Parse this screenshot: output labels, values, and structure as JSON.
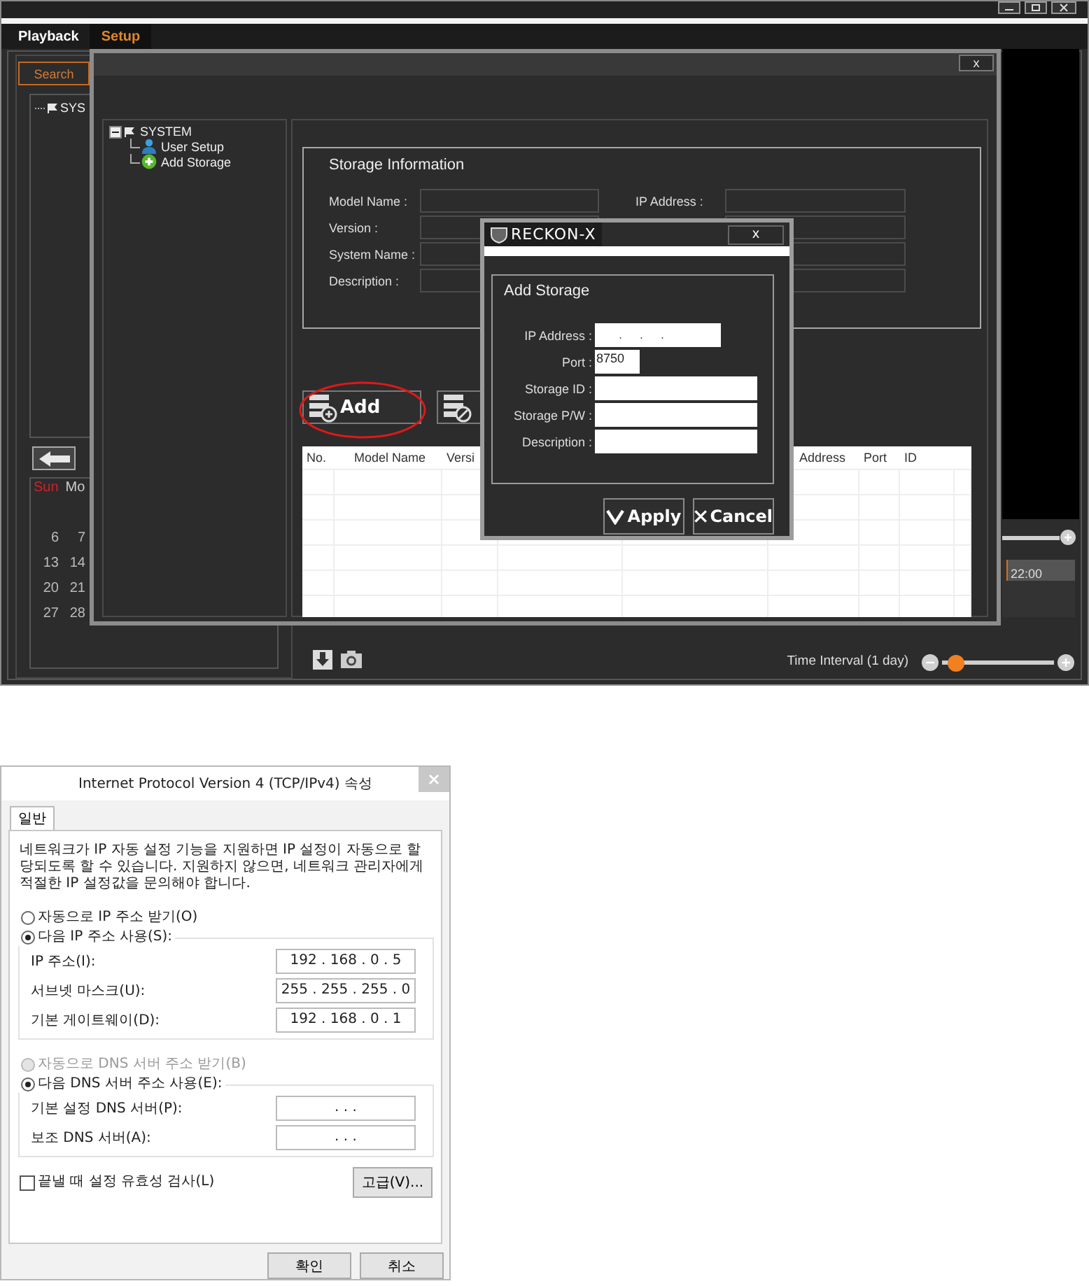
{
  "app": {
    "tabs": [
      {
        "label": "Playback",
        "selected": false
      },
      {
        "label": "Setup",
        "selected": true
      }
    ],
    "search_button": "Search",
    "device_tree": {
      "label": "SYS"
    },
    "calendar": {
      "weekdays": [
        {
          "label": "Sun",
          "weekend": true
        },
        {
          "label": "Mo",
          "weekend": false
        }
      ],
      "weeks": [
        [
          "6",
          "7"
        ],
        [
          "13",
          "14"
        ],
        [
          "20",
          "21"
        ],
        [
          "27",
          "28"
        ]
      ]
    },
    "timeline": {
      "time_label": "22:00"
    },
    "time_interval": {
      "label": "Time Interval (1 day)",
      "level": 0.06
    }
  },
  "setup_window": {
    "close": "x",
    "tree": {
      "label": "SYSTEM",
      "expanded": true,
      "children": [
        {
          "label": "User Setup",
          "kind": "user"
        },
        {
          "label": "Add Storage",
          "kind": "add"
        }
      ]
    },
    "storage_info": {
      "title": "Storage Information",
      "fields": [
        {
          "label": "Model Name :"
        },
        {
          "label": "Version :"
        },
        {
          "label": "System Name :"
        },
        {
          "label": "Description :"
        }
      ],
      "right_label": "IP Address :"
    },
    "buttons": [
      {
        "label": "Add",
        "kind": "add",
        "highlighted": true
      },
      {
        "kind": "delete",
        "highlighted": false
      }
    ],
    "table": {
      "columns": [
        "No.",
        "Model Name",
        "Versi",
        "Address",
        "Port",
        "ID"
      ]
    }
  },
  "add_storage_dialog": {
    "brand": "RECKON-X",
    "close": "x",
    "title": "Add Storage",
    "fields": [
      {
        "label": "IP Address :",
        "kind": "ip",
        "value": ". . ."
      },
      {
        "label": "Port :",
        "kind": "short",
        "value": "8750"
      },
      {
        "label": "Storage ID :",
        "kind": "text"
      },
      {
        "label": "Storage P/W :",
        "kind": "text"
      },
      {
        "label": "Description :",
        "kind": "text"
      }
    ],
    "buttons": [
      {
        "label": "Apply",
        "kind": "apply"
      },
      {
        "label": "Cancel",
        "kind": "cancel"
      }
    ]
  },
  "ipv4_dialog": {
    "title": "Internet Protocol Version 4 (TCP/IPv4) 속성",
    "tabs": [
      {
        "label": "일반",
        "selected": true
      }
    ],
    "description": "네트워크가 IP 자동 설정 기능을 지원하면 IP 설정이 자동으로 할당되도록 할 수 있습니다. 지원하지 않으면, 네트워크 관리자에게 적절한 IP 설정값을 문의해야 합니다.",
    "ip_options": [
      {
        "label": "자동으로 IP 주소 받기(O)",
        "selected": false,
        "disabled": false
      },
      {
        "label": "다음 IP 주소 사용(S):",
        "selected": true,
        "disabled": false
      }
    ],
    "ip_fields": [
      {
        "label": "IP 주소(I):",
        "value": "192 . 168 . 0 . 5"
      },
      {
        "label": "서브넷 마스크(U):",
        "value": "255 . 255 . 255 . 0"
      },
      {
        "label": "기본 게이트웨이(D):",
        "value": "192 . 168 . 0 . 1"
      }
    ],
    "dns_options": [
      {
        "label": "자동으로 DNS 서버 주소 받기(B)",
        "selected": false,
        "disabled": true
      },
      {
        "label": "다음 DNS 서버 주소 사용(E):",
        "selected": true,
        "disabled": false
      }
    ],
    "dns_fields": [
      {
        "label": "기본 설정 DNS 서버(P):",
        "value": ". . ."
      },
      {
        "label": "보조 DNS 서버(A):",
        "value": ". . ."
      }
    ],
    "validate": {
      "label": "끝낼 때 설정 유효성 검사(L)",
      "checked": false
    },
    "advanced_button": "고급(V)...",
    "buttons": [
      "확인",
      "취소"
    ]
  }
}
